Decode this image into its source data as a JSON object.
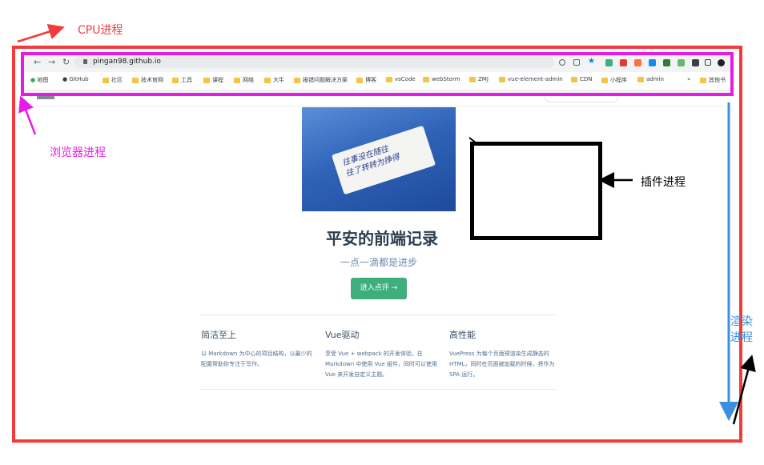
{
  "annotations": {
    "cpu": "CPU进程",
    "browser": "浏览器进程",
    "plugin": "插件进程",
    "render": "渲染\n进程",
    "colors": {
      "cpu": "#f23b3b",
      "browser": "#e61ce6",
      "plugin": "#000000",
      "render": "#3b8fe0"
    }
  },
  "browser": {
    "url": "pingan98.github.io",
    "bookmarks": [
      "地图",
      "GitHub",
      "社区",
      "技术官网",
      "工具",
      "课程",
      "网络",
      "大牛",
      "报错问题解决方案",
      "博客",
      "vsCode",
      "webStorm",
      "ZMJ",
      "vue-element-admin",
      "CDN",
      "小程序",
      "admin",
      "»",
      "其他书"
    ]
  },
  "site": {
    "hero_title": "平安的前端记录",
    "hero_sub": "一点一滴都是进步",
    "cta": "进入点评 →",
    "flag_line1": "往事没在随往",
    "flag_line2": "往了转转为挣得"
  },
  "features": [
    {
      "title": "简洁至上",
      "desc": "以 Markdown 为中心的项目结构，以最少的配置帮助你专注于写作。"
    },
    {
      "title": "Vue驱动",
      "desc": "享受 Vue + webpack 的开发体验，在 Markdown 中使用 Vue 组件，同时可以使用 Vue 来开发自定义主题。"
    },
    {
      "title": "高性能",
      "desc": "VuePress 为每个页面预渲染生成静态的 HTML，同时在页面被加载的时候，将作为 SPA 运行。"
    }
  ]
}
